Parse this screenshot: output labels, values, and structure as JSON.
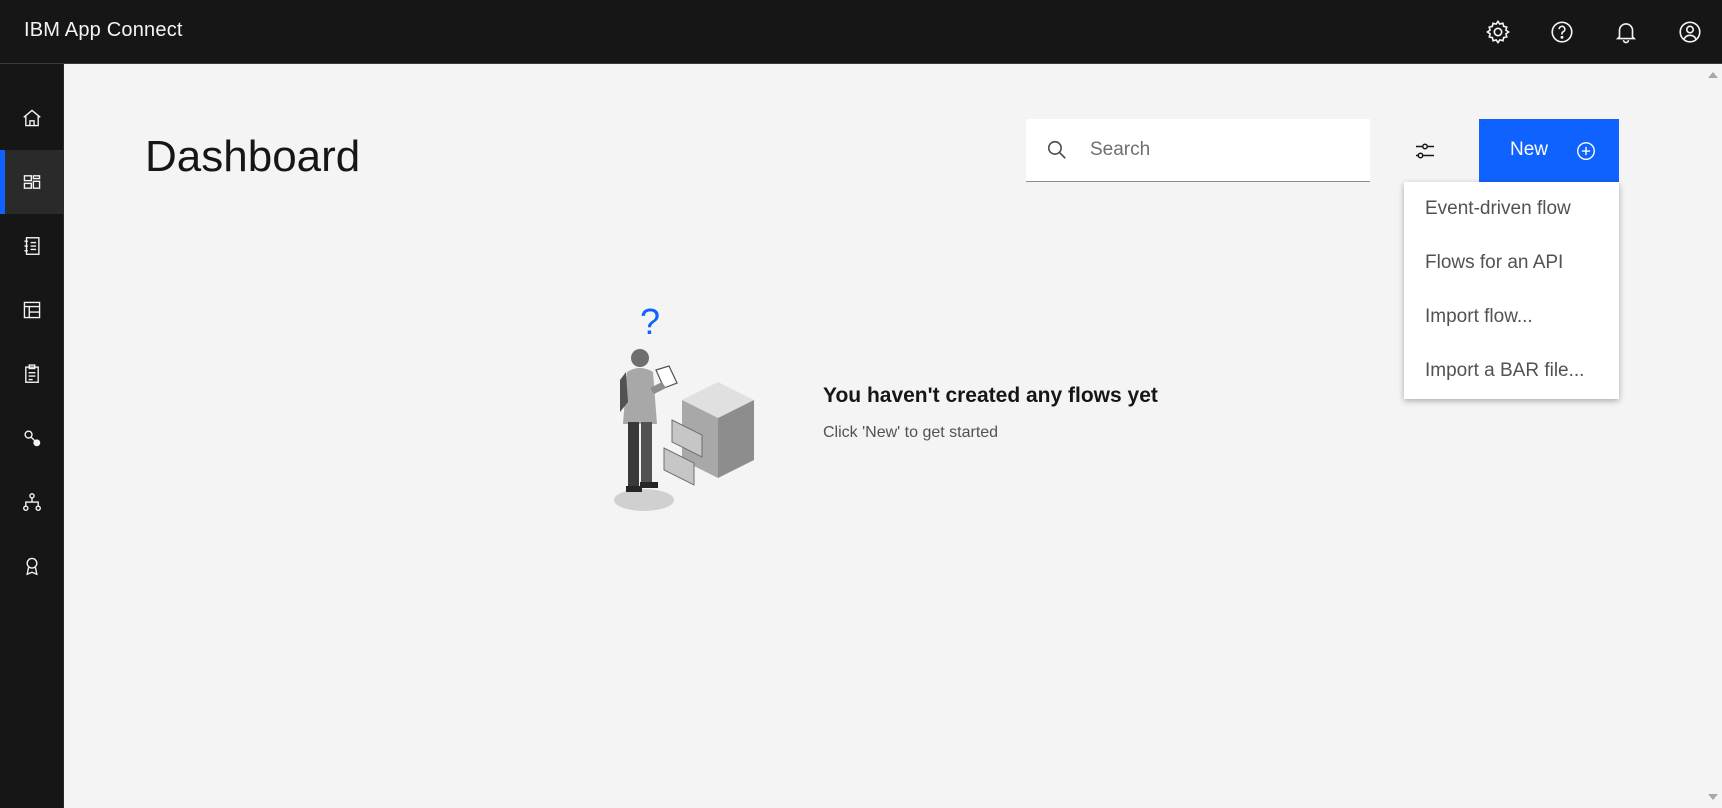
{
  "app": {
    "title": "IBM App Connect"
  },
  "header": {
    "icons": [
      "gear-icon",
      "help-icon",
      "notification-icon",
      "user-avatar-icon"
    ]
  },
  "sidebar": {
    "items": [
      {
        "icon": "home-icon",
        "active": false
      },
      {
        "icon": "dashboard-icon",
        "active": true
      },
      {
        "icon": "catalog-icon",
        "active": false
      },
      {
        "icon": "templates-icon",
        "active": false
      },
      {
        "icon": "clipboard-icon",
        "active": false
      },
      {
        "icon": "connections-icon",
        "active": false
      },
      {
        "icon": "hierarchy-icon",
        "active": false
      },
      {
        "icon": "badge-icon",
        "active": false
      }
    ]
  },
  "page": {
    "title": "Dashboard"
  },
  "search": {
    "placeholder": "Search",
    "value": ""
  },
  "toolbar": {
    "new_label": "New"
  },
  "new_menu": {
    "items": [
      "Event-driven flow",
      "Flows for an API",
      "Import flow...",
      "Import a BAR file..."
    ]
  },
  "empty_state": {
    "illustration_mark": "?",
    "title": "You haven't created any flows yet",
    "subtitle": "Click 'New' to get started"
  },
  "colors": {
    "header_bg": "#161616",
    "page_bg": "#f4f4f4",
    "accent": "#0f62fe",
    "illustration_mark": "#0f62fe"
  }
}
